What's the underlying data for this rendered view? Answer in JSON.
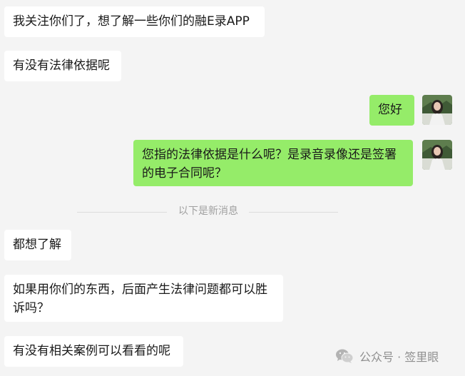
{
  "messages": [
    {
      "side": "left",
      "text": "我关注你们了，想了解一些你们的融E录APP"
    },
    {
      "side": "left",
      "text": "有没有法律依据呢"
    },
    {
      "side": "right",
      "text": "您好"
    },
    {
      "side": "right",
      "text": "您指的法律依据是什么呢？是录音录像还是签署的电子合同呢？"
    },
    {
      "side": "left",
      "text": "都想了解"
    },
    {
      "side": "left",
      "text": "如果用你们的东西，后面产生法律问题都可以胜诉吗？"
    },
    {
      "side": "left",
      "text": "有没有相关案例可以看看的呢"
    }
  ],
  "divider": {
    "text": "以下是新消息"
  },
  "watermark": {
    "icon": "wechat-icon",
    "text": "公众号 · 签里眼"
  },
  "colors": {
    "background": "#f4f4f4",
    "left_bubble": "#ffffff",
    "right_bubble": "#95ec69"
  }
}
